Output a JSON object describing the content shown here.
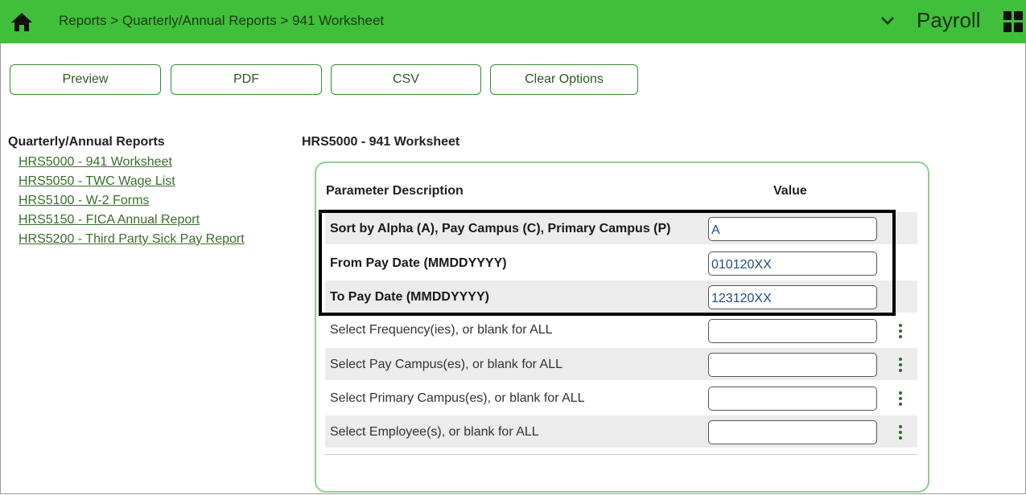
{
  "header": {
    "breadcrumb": "Reports > Quarterly/Annual Reports > 941 Worksheet",
    "module": "Payroll",
    "home_icon": "home-icon",
    "menu_icon": "chevron-down-icon",
    "apps_icon": "app-grid-icon",
    "bg_color": "#3fbf3a"
  },
  "toolbar": {
    "preview": "Preview",
    "pdf": "PDF",
    "csv": "CSV",
    "clear": "Clear Options"
  },
  "sidebar": {
    "heading": "Quarterly/Annual Reports",
    "links": [
      "HRS5000 - 941 Worksheet",
      "HRS5050 - TWC Wage List",
      "HRS5100 - W-2 Forms",
      "HRS5150 - FICA Annual Report",
      "HRS5200 - Third Party Sick Pay Report"
    ]
  },
  "main": {
    "title": "HRS5000 - 941 Worksheet",
    "col_description": "Parameter Description",
    "col_value": "Value",
    "params": [
      {
        "label": "Sort by Alpha (A), Pay Campus (C), Primary Campus (P)",
        "value": "A"
      },
      {
        "label": "From Pay Date (MMDDYYYY)",
        "value": "010120XX"
      },
      {
        "label": "To Pay Date (MMDDYYYY)",
        "value": "123120XX"
      },
      {
        "label": "Select Frequency(ies), or blank for ALL",
        "value": ""
      },
      {
        "label": "Select Pay Campus(es), or blank for ALL",
        "value": ""
      },
      {
        "label": "Select Primary Campus(es), or blank for ALL",
        "value": ""
      },
      {
        "label": "Select Employee(s), or blank for ALL",
        "value": ""
      }
    ]
  }
}
